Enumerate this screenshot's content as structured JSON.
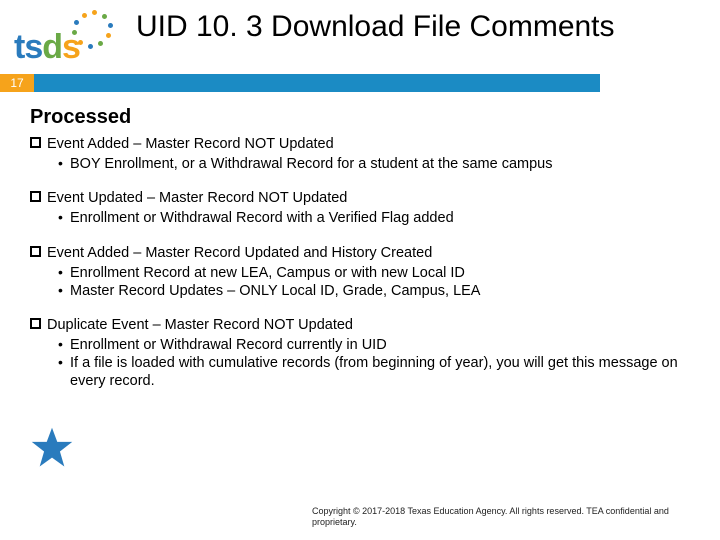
{
  "logo": {
    "text_t": "t",
    "text_s1": "s",
    "text_d": "d",
    "text_s2": "s"
  },
  "title": "UID 10. 3 Download File Comments",
  "page_number": "17",
  "section_heading": "Processed",
  "groups": [
    {
      "headline": "Event Added – Master Record NOT Updated",
      "subs": [
        "BOY Enrollment, or a Withdrawal Record for a student at the same campus"
      ]
    },
    {
      "headline": "Event Updated – Master Record NOT Updated",
      "subs": [
        "Enrollment or Withdrawal Record with a Verified Flag added"
      ]
    },
    {
      "headline": "Event Added – Master Record Updated and History Created",
      "subs": [
        "Enrollment Record at new LEA, Campus or with new Local ID",
        "Master Record Updates – ONLY Local ID, Grade, Campus, LEA"
      ]
    },
    {
      "headline": "Duplicate Event – Master Record NOT Updated",
      "subs": [
        "Enrollment or Withdrawal Record currently in UID",
        "If a file is loaded with cumulative records (from beginning of year), you will get this message on every record."
      ]
    }
  ],
  "footer": "Copyright © 2017-2018 Texas Education Agency. All rights reserved. TEA confidential and proprietary.",
  "colors": {
    "blue": "#1b8bc4",
    "orange": "#f6a31b",
    "green": "#6aa946",
    "star": "#2a7bbd"
  }
}
